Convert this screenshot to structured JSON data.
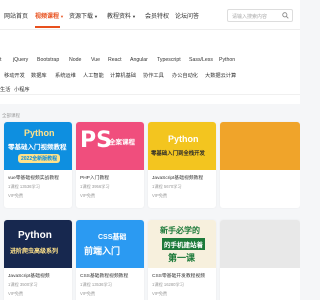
{
  "nav": {
    "home": "网站首页",
    "courses": "视频课程",
    "downloads": "资源下载",
    "articles": "教程资料",
    "vip": "会员特权",
    "forum": "论坛问答"
  },
  "search": {
    "placeholder": "请输入搜索内容"
  },
  "filters": {
    "row1": [
      "ipt",
      "jQuery",
      "Bootstrap",
      "Node",
      "Vue",
      "React",
      "Angular",
      "Typescript",
      "Sass/Less",
      "Python"
    ],
    "row2": [
      "移动开发",
      "数据库",
      "系统运维",
      "人工智能",
      "计算机基础",
      "协作工具",
      "办公自动化",
      "大数据云计算"
    ],
    "row3": [
      "生活",
      "小程序"
    ]
  },
  "section": {
    "label": "全部课程"
  },
  "courses": [
    {
      "thumb_line1": "Python",
      "thumb_line2": "零基础入门视频教程",
      "thumb_line3": "2022全新版教程",
      "title": "vue零基础视频实战教程",
      "meta": "1课程 13536学习",
      "tag": "VIP免费"
    },
    {
      "thumb_line1": "PS",
      "thumb_line2": "全案课程",
      "title": "PHP入门教程",
      "meta": "1课程 3956学习",
      "tag": "VIP免费"
    },
    {
      "thumb_line1": "Python",
      "thumb_line2": "零基础入门到全栈开发",
      "title": "JavaScript基础视频教程",
      "meta": "1课程 5670学习",
      "tag": "VIP免费"
    },
    {
      "thumb_line1": "Python",
      "thumb_line2": "进阶爬虫高级系列",
      "title": "JavaScript基础视频",
      "meta": "1课程 3500学习",
      "tag": "VIP免费"
    },
    {
      "thumb_line1": "CSS基础",
      "thumb_line2": "前端入门",
      "title": "CSS基础教程视频教程",
      "meta": "1课程 13536学习",
      "tag": "VIP免费"
    },
    {
      "thumb_line1": "新手必学的",
      "thumb_line2": "的手机建站着",
      "thumb_line3": "第一课",
      "title": "CSS零基础开发教程视频",
      "meta": "1课程 16280学习",
      "tag": "VIP免费"
    }
  ],
  "colors": {
    "accent": "#e8501d",
    "python_bg": "#0e8fe0",
    "ps_bg": "#f04e7d",
    "yellow_bg": "#f3c51f",
    "dark_bg": "#17284f",
    "blue_bg": "#2b9af2",
    "light_bg": "#f7f0dd"
  }
}
